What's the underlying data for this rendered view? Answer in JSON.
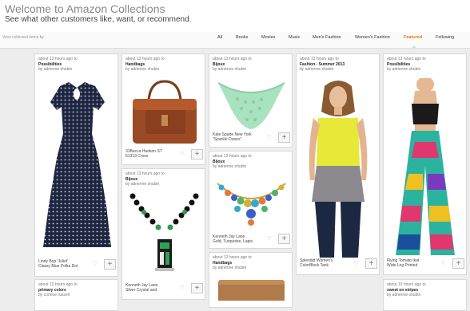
{
  "header": {
    "title": "Welcome to Amazon Collections",
    "subtitle": "See what other customers like, want, or recommend."
  },
  "filters": {
    "label": "View collected items by",
    "items": [
      "All",
      "Books",
      "Movies",
      "Music",
      "Men's Fashion",
      "Women's Fashion",
      "Featured",
      "Following"
    ],
    "active": "Featured"
  },
  "cards": [
    {
      "time": "about 13 hours ago to",
      "collection": "Possibilities",
      "by": "by adrienne shubin",
      "caption1": "Lindy Bop 'Juliet'",
      "caption2": "Classy Blue Polka Dot",
      "image": "navy-polka-dot-dress"
    },
    {
      "time": "about 13 hours ago to",
      "collection": "Handbags",
      "by": "by adrienne shubin",
      "caption1": "31Becca Hudson ST",
      "caption2": "61313 Cross",
      "image": "brown-leather-handbag"
    },
    {
      "time": "about 13 hours ago to",
      "collection": "Bijoux",
      "by": "by adrienne shubin",
      "caption1": "",
      "caption2": "",
      "image": "black-green-pendant-necklace"
    },
    {
      "time": "about 13 hours ago to",
      "collection": "Bijoux",
      "by": "by adrienne shubin",
      "caption1": "Kate Spade New York",
      "caption2": "\"Sparkle Dunes\"",
      "image": "mint-bib-necklace"
    },
    {
      "time": "about 13 hours ago to",
      "collection": "Bijoux",
      "by": "by adrienne shubin",
      "caption1": "Kenneth Jay Lane",
      "caption2": "Gold, Turquoise, Lapis",
      "image": "gold-turquoise-necklace"
    },
    {
      "time": "about 13 hours ago to",
      "collection": "Handbags",
      "by": "by adrienne shubin",
      "caption1": "",
      "caption2": "",
      "image": "tan-bag-partial"
    },
    {
      "time": "about 13 hours ago to",
      "collection": "Fashion - Summer 2013",
      "by": "by adrienne shubin",
      "caption1": "Splendid Women's",
      "caption2": "ColorBlock Tank",
      "image": "yellow-grey-tank-model"
    },
    {
      "time": "about 13 hours ago to",
      "collection": "Possibilities",
      "by": "by adrienne shubin",
      "caption1": "Flying Tomato Ikat",
      "caption2": "Wide Leg Printed",
      "image": "ikat-pants-model"
    },
    {
      "time": "about 13 hours ago to",
      "collection": "primary colors",
      "by": "by corinne russell",
      "caption1": "",
      "caption2": "",
      "image": ""
    },
    {
      "time": "about 13 hours ago to",
      "collection": "sweet on stripes",
      "by": "by adrienne shubin",
      "caption1": "",
      "caption2": "",
      "image": ""
    }
  ],
  "extra_captions": {
    "necklace_black_1": "Kenneth Jay Lane",
    "necklace_black_2": "Silver Crystal and"
  },
  "icons": {
    "like": "heart-icon",
    "add": "plus-icon"
  },
  "colors": {
    "accent": "#e47911",
    "background": "#ededed"
  }
}
